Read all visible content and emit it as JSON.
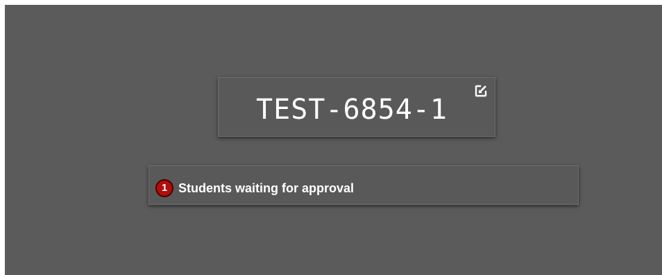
{
  "session": {
    "code": "TEST-6854-1",
    "open_icon": "open-external-icon"
  },
  "approvals": {
    "count": "1",
    "label": "Students waiting for approval",
    "badge_color": "#b00d0d"
  },
  "colors": {
    "background": "#5b5b5b",
    "card": "#595959",
    "text": "#ffffff"
  }
}
